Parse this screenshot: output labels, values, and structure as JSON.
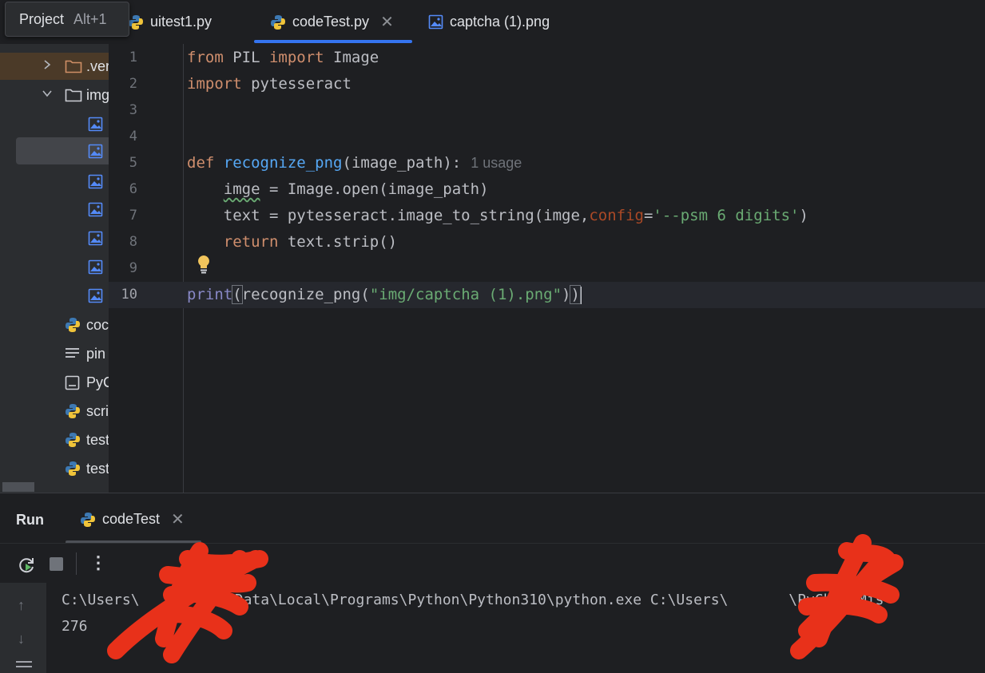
{
  "tooltip": {
    "label": "Project",
    "shortcut": "Alt+1"
  },
  "tabs": [
    {
      "label": "uitest1.py",
      "icon": "python-file-icon",
      "active": false
    },
    {
      "label": "codeTest.py",
      "icon": "python-file-icon",
      "active": true,
      "close": "✕"
    },
    {
      "label": "captcha (1).png",
      "icon": "image-file-icon",
      "active": false
    }
  ],
  "tree": {
    "items": [
      {
        "label": ".ver",
        "icon": "folder-icon",
        "chevron": "›"
      },
      {
        "label": "img",
        "icon": "folder-icon",
        "chevron": "⌄"
      },
      {
        "label": "",
        "icon": "image-file-icon"
      },
      {
        "label": "",
        "icon": "image-file-icon"
      },
      {
        "label": "",
        "icon": "image-file-icon"
      },
      {
        "label": "",
        "icon": "image-file-icon"
      },
      {
        "label": "",
        "icon": "image-file-icon"
      },
      {
        "label": "",
        "icon": "image-file-icon"
      },
      {
        "label": "",
        "icon": "image-file-icon"
      },
      {
        "label": "coc",
        "icon": "python-file-icon"
      },
      {
        "label": "pin",
        "icon": "text-file-icon"
      },
      {
        "label": "PyC",
        "icon": "document-icon"
      },
      {
        "label": "scri",
        "icon": "python-file-icon"
      },
      {
        "label": "test",
        "icon": "python-file-icon"
      },
      {
        "label": "test",
        "icon": "python-file-icon"
      }
    ]
  },
  "editor": {
    "line_numbers": [
      "1",
      "2",
      "3",
      "4",
      "5",
      "6",
      "7",
      "8",
      "9",
      "10"
    ],
    "current_line": "10",
    "usage_hint": "1 usage",
    "lines": {
      "l1": {
        "kw1": "from",
        "mod": " PIL ",
        "kw2": "import",
        "name": " Image"
      },
      "l2": {
        "kw": "import",
        "mod": " pytesseract"
      },
      "l5": {
        "kw": "def",
        "fn": "recognize_png",
        "args": "(image_path):"
      },
      "l6": {
        "indent": "    ",
        "var": "imge",
        "rest": " = Image.open(image_path)"
      },
      "l7": {
        "indent": "    ",
        "pre": "text = pytesseract.image_to_string(imge,",
        "param": "config",
        "eq": "=",
        "str": "'--psm 6 digits'",
        "post": ")"
      },
      "l8": {
        "indent": "    ",
        "kw": "return",
        "rest": " text.strip()"
      },
      "l10": {
        "bi": "print",
        "open": "(",
        "call": "recognize_png(",
        "str": "\"img/captcha (1).png\"",
        "close1": ")",
        "close2": ")"
      }
    }
  },
  "run": {
    "title": "Run",
    "tab_label": "codeTest",
    "tab_close": "✕",
    "more": "⋮",
    "up": "↑",
    "down": "↓",
    "output": [
      "C:\\Users\\       \\AppData\\Local\\Programs\\Python\\Python310\\python.exe C:\\Users\\       \\PyCharmMis",
      "276"
    ]
  },
  "colors": {
    "background": "#1e1f22",
    "accent": "#3574f0",
    "keyword": "#cf8e6d",
    "function": "#56a8f5",
    "string": "#6aab73",
    "redaction": "#e8311a"
  }
}
